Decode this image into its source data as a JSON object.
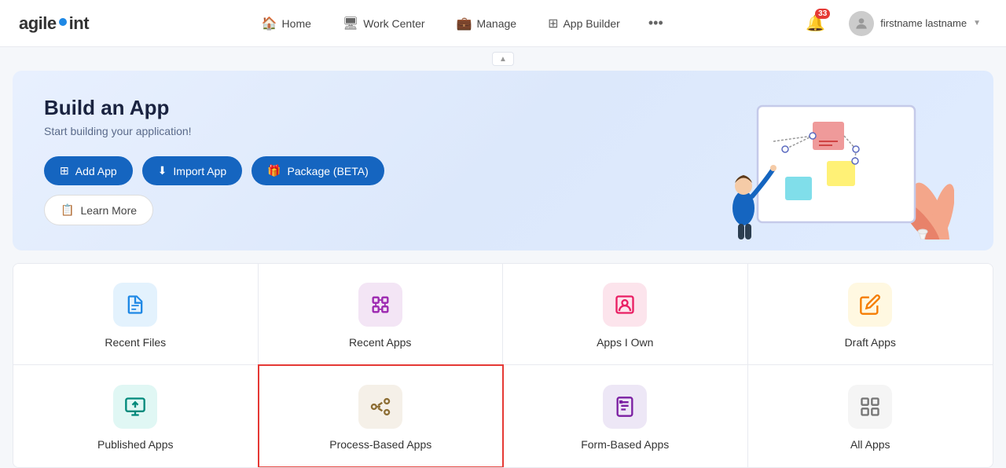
{
  "header": {
    "logo_text_before": "agile",
    "logo_text_after": "int",
    "nav_items": [
      {
        "label": "Home",
        "icon": "🏠",
        "id": "home"
      },
      {
        "label": "Work Center",
        "icon": "🖥",
        "id": "work-center"
      },
      {
        "label": "Manage",
        "icon": "💼",
        "id": "manage"
      },
      {
        "label": "App Builder",
        "icon": "⊞",
        "id": "app-builder"
      }
    ],
    "more_label": "•••",
    "notification_count": "33",
    "user_name": "firstname lastname"
  },
  "hero": {
    "title": "Build an App",
    "subtitle": "Start building your application!",
    "buttons": [
      {
        "label": "Add App",
        "icon": "⊞",
        "type": "primary",
        "id": "add-app"
      },
      {
        "label": "Import App",
        "icon": "⬇",
        "type": "primary",
        "id": "import-app"
      },
      {
        "label": "Package (BETA)",
        "icon": "🎁",
        "type": "primary",
        "id": "package-beta"
      },
      {
        "label": "Learn More",
        "icon": "📋",
        "type": "outline",
        "id": "learn-more"
      }
    ]
  },
  "app_grid": {
    "items": [
      {
        "id": "recent-files",
        "label": "Recent Files",
        "icon_color": "icon-blue",
        "icon": "📄",
        "selected": false
      },
      {
        "id": "recent-apps",
        "label": "Recent Apps",
        "icon_color": "icon-purple",
        "icon": "📦",
        "selected": false
      },
      {
        "id": "apps-i-own",
        "label": "Apps I Own",
        "icon_color": "icon-pink",
        "icon": "👤",
        "selected": false
      },
      {
        "id": "draft-apps",
        "label": "Draft Apps",
        "icon_color": "icon-gold",
        "icon": "✏️",
        "selected": false
      },
      {
        "id": "published-apps",
        "label": "Published Apps",
        "icon_color": "icon-teal",
        "icon": "⬆",
        "selected": false
      },
      {
        "id": "process-based-apps",
        "label": "Process-Based Apps",
        "icon_color": "icon-tan",
        "icon": "⠿",
        "selected": true
      },
      {
        "id": "form-based-apps",
        "label": "Form-Based Apps",
        "icon_color": "icon-lavender",
        "icon": "📋",
        "selected": false
      },
      {
        "id": "all-apps",
        "label": "All Apps",
        "icon_color": "icon-gray",
        "icon": "⊞",
        "selected": false
      }
    ]
  },
  "collapse_icon": "▲"
}
